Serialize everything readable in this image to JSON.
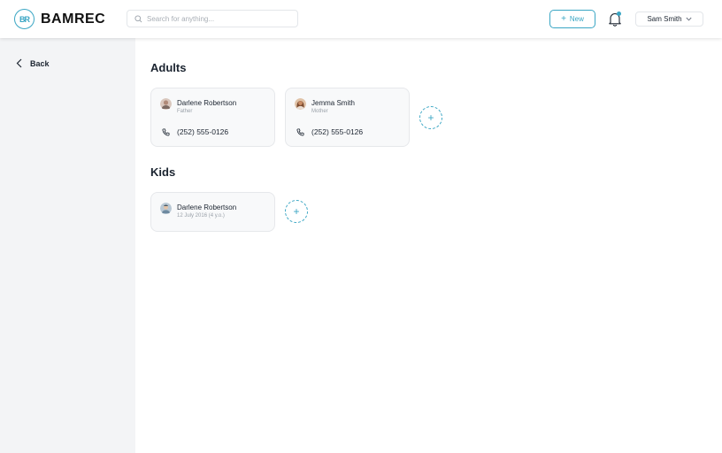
{
  "brand": {
    "mark": "BR",
    "name": "BAMREC",
    "accent": "#3aa6c4"
  },
  "search": {
    "placeholder": "Search for anything..."
  },
  "header": {
    "new_label": "New",
    "user_name": "Sam Smith"
  },
  "sidebar": {
    "back_label": "Back"
  },
  "adults": {
    "title": "Adults",
    "members": [
      {
        "name": "Darlene Robertson",
        "role": "Father",
        "phone": "(252) 555-0126",
        "avatar_color": "#b08a78"
      },
      {
        "name": "Jemma Smith",
        "role": "Mother",
        "phone": "(252) 555-0126",
        "avatar_color": "#9c6a4e"
      }
    ]
  },
  "kids": {
    "title": "Kids",
    "members": [
      {
        "name": "Darlene Robertson",
        "birth": "12 July 2016 (4 y.o.)",
        "avatar_color": "#6e8aa0"
      }
    ]
  },
  "icons": {
    "add": "+",
    "chevron": "chevron-down-icon",
    "bell": "bell-icon",
    "phone": "phone-icon"
  }
}
